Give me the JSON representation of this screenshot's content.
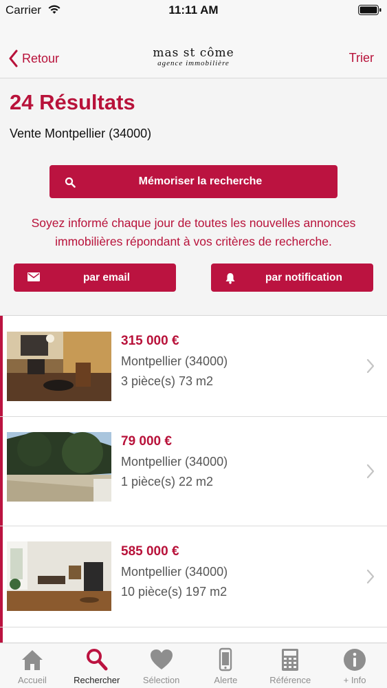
{
  "status_bar": {
    "carrier": "Carrier",
    "time": "11:11 AM"
  },
  "nav": {
    "back_label": "Retour",
    "logo_title": "mas st côme",
    "logo_subtitle": "agence immobilière",
    "sort_label": "Trier"
  },
  "results": {
    "title": "24 Résultats",
    "search_description": "Vente Montpellier (34000)",
    "save_search_label": "Mémoriser la recherche",
    "info_line1": "Soyez informé chaque jour de toutes les nouvelles annonces",
    "info_line2": "immobilières répondant à vos critères de recherche.",
    "email_label": "par email",
    "notification_label": "par notification"
  },
  "listings": [
    {
      "price": "315 000  €",
      "city": "Montpellier (34000)",
      "rooms": "3 pièce(s) 73 m2"
    },
    {
      "price": "79 000  €",
      "city": "Montpellier (34000)",
      "rooms": "1 pièce(s) 22 m2"
    },
    {
      "price": "585 000  €",
      "city": "Montpellier (34000)",
      "rooms": "10 pièce(s) 197 m2"
    }
  ],
  "tabs": [
    {
      "label": "Accueil",
      "icon": "home-icon",
      "active": false
    },
    {
      "label": "Rechercher",
      "icon": "search-icon",
      "active": true
    },
    {
      "label": "Sélection",
      "icon": "heart-icon",
      "active": false
    },
    {
      "label": "Alerte",
      "icon": "phone-icon",
      "active": false
    },
    {
      "label": "Référence",
      "icon": "calculator-icon",
      "active": false
    },
    {
      "label": "+ Info",
      "icon": "info-icon",
      "active": false
    }
  ],
  "colors": {
    "accent": "#bb1340",
    "tab_inactive": "#8e8e8e",
    "background": "#f4f4f4"
  }
}
